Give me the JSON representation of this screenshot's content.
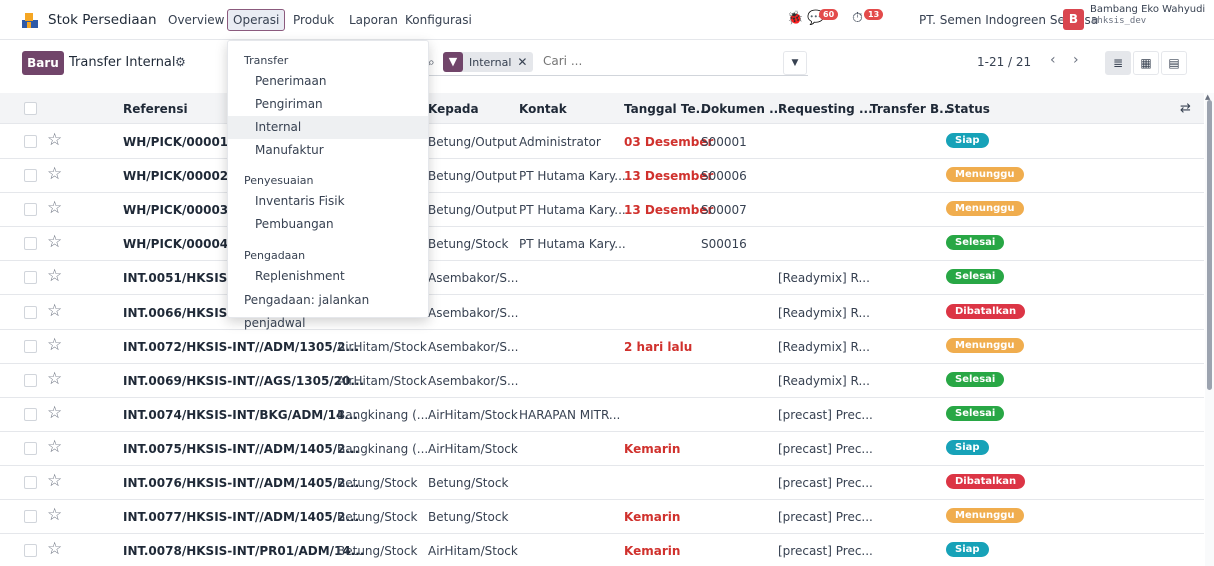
{
  "navbar": {
    "app_name": "Stok Persediaan",
    "menu": [
      "Overview",
      "Operasi",
      "Produk",
      "Laporan",
      "Konfigurasi"
    ],
    "activity_count": "60",
    "timer_count": "13",
    "company": "PT. Semen Indogreen Sentosa",
    "avatar_letter": "B",
    "user_name": "Bambang Eko Wahyudi",
    "database": "hksis_dev"
  },
  "control": {
    "new_label": "Baru",
    "breadcrumb": "Transfer Internal",
    "facet_label": "Internal",
    "search_placeholder": "Cari ...",
    "pager": "1-21 / 21"
  },
  "table": {
    "headers": [
      "Referensi",
      "Dari",
      "Kepada",
      "Kontak",
      "Tanggal Te...",
      "Dokumen ...",
      "Requesting ...",
      "Transfer B...",
      "Status"
    ],
    "rows": [
      {
        "ref": "WH/PICK/00001",
        "from": "",
        "to": "Betung/Output",
        "contact": "Administrator",
        "date": "03 Desember",
        "date_red": true,
        "doc": "S00001",
        "req": "",
        "status": "Siap",
        "status_color": "#17a2b8"
      },
      {
        "ref": "WH/PICK/00002",
        "from": "",
        "to": "Betung/Output",
        "contact": "PT Hutama Kary...",
        "date": "13 Desember",
        "date_red": true,
        "doc": "S00006",
        "req": "",
        "status": "Menunggu",
        "status_color": "#f0ad4e"
      },
      {
        "ref": "WH/PICK/00003",
        "from": "",
        "to": "Betung/Output",
        "contact": "PT Hutama Kary...",
        "date": "13 Desember",
        "date_red": true,
        "doc": "S00007",
        "req": "",
        "status": "Menunggu",
        "status_color": "#f0ad4e"
      },
      {
        "ref": "WH/PICK/00004",
        "from": "",
        "to": "Betung/Stock",
        "contact": "PT Hutama Kary...",
        "date": "",
        "date_red": false,
        "doc": "S00016",
        "req": "",
        "status": "Selesai",
        "status_color": "#28a745"
      },
      {
        "ref": "INT.0051/HKSIS-IN",
        "from": "",
        "to": "Asembakor/S...",
        "contact": "",
        "date": "",
        "date_red": false,
        "doc": "",
        "req": "[Readymix] R...",
        "status": "Selesai",
        "status_color": "#28a745"
      },
      {
        "ref": "INT.0066/HKSIS-IN",
        "from": "",
        "to": "Asembakor/S...",
        "contact": "",
        "date": "",
        "date_red": false,
        "doc": "",
        "req": "[Readymix] R...",
        "status": "Dibatalkan",
        "status_color": "#dc3545"
      },
      {
        "ref": "INT.0072/HKSIS-INT//ADM/1305/2...",
        "from": "AirHitam/Stock",
        "to": "Asembakor/S...",
        "contact": "",
        "date": "2 hari lalu",
        "date_red": true,
        "doc": "",
        "req": "[Readymix] R...",
        "status": "Menunggu",
        "status_color": "#f0ad4e"
      },
      {
        "ref": "INT.0069/HKSIS-INT//AGS/1305/20...",
        "from": "AirHitam/Stock",
        "to": "Asembakor/S...",
        "contact": "",
        "date": "",
        "date_red": false,
        "doc": "",
        "req": "[Readymix] R...",
        "status": "Selesai",
        "status_color": "#28a745"
      },
      {
        "ref": "INT.0074/HKSIS-INT/BKG/ADM/14...",
        "from": "Bangkinang (...",
        "to": "AirHitam/Stock",
        "contact": "HARAPAN MITR...",
        "date": "",
        "date_red": false,
        "doc": "",
        "req": "[precast] Prec...",
        "status": "Selesai",
        "status_color": "#28a745"
      },
      {
        "ref": "INT.0075/HKSIS-INT//ADM/1405/2...",
        "from": "Bangkinang (...",
        "to": "AirHitam/Stock",
        "contact": "",
        "date": "Kemarin",
        "date_red": true,
        "doc": "",
        "req": "[precast] Prec...",
        "status": "Siap",
        "status_color": "#17a2b8"
      },
      {
        "ref": "INT.0076/HKSIS-INT//ADM/1405/2...",
        "from": "Betung/Stock",
        "to": "Betung/Stock",
        "contact": "",
        "date": "",
        "date_red": false,
        "doc": "",
        "req": "[precast] Prec...",
        "status": "Dibatalkan",
        "status_color": "#dc3545"
      },
      {
        "ref": "INT.0077/HKSIS-INT//ADM/1405/2...",
        "from": "Betung/Stock",
        "to": "Betung/Stock",
        "contact": "",
        "date": "Kemarin",
        "date_red": true,
        "doc": "",
        "req": "[precast] Prec...",
        "status": "Menunggu",
        "status_color": "#f0ad4e"
      },
      {
        "ref": "INT.0078/HKSIS-INT/PR01/ADM/14...",
        "from": "Betung/Stock",
        "to": "AirHitam/Stock",
        "contact": "",
        "date": "Kemarin",
        "date_red": true,
        "doc": "",
        "req": "[precast] Prec...",
        "status": "Siap",
        "status_color": "#17a2b8"
      }
    ]
  },
  "dropdown": {
    "section_transfer": "Transfer",
    "transfer_items": [
      "Penerimaan",
      "Pengiriman",
      "Internal",
      "Manufaktur"
    ],
    "section_adjust": "Penyesuaian",
    "adjust_items": [
      "Inventaris Fisik",
      "Pembuangan"
    ],
    "section_procure": "Pengadaan",
    "procure_items": [
      "Replenishment"
    ],
    "run_scheduler": "Pengadaan: jalankan penjadwal"
  }
}
